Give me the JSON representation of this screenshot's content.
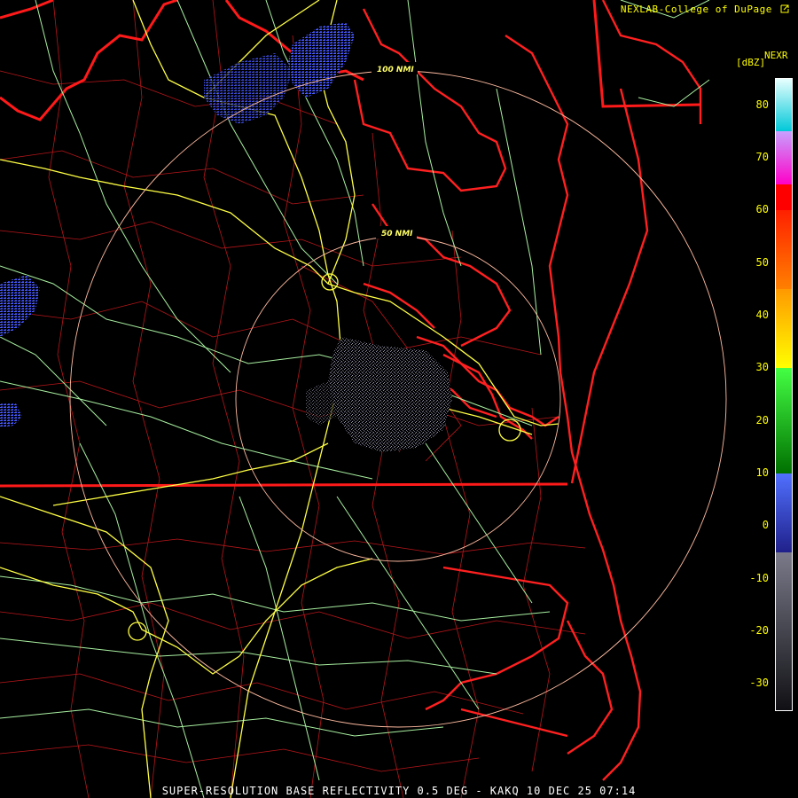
{
  "header": {
    "credit": "NEXLAB-College of DuPage",
    "credit_icon": "external-link-icon"
  },
  "legend": {
    "product": "NEXR",
    "unit": "[dBZ]",
    "min": -35,
    "max": 85,
    "ticks": [
      "80",
      "70",
      "60",
      "50",
      "40",
      "30",
      "20",
      "10",
      "0",
      "-10",
      "-20",
      "-30"
    ],
    "tick_values": [
      80,
      70,
      60,
      50,
      40,
      30,
      20,
      10,
      0,
      -10,
      -20,
      -30
    ],
    "segments": [
      {
        "from": 75,
        "to": 85,
        "color_top": "#e8ffff",
        "color_bottom": "#00c8d8"
      },
      {
        "from": 65,
        "to": 75,
        "color_top": "#c8a0ff",
        "color_bottom": "#ff00c8"
      },
      {
        "from": 60,
        "to": 65,
        "color_top": "#ff0000",
        "color_bottom": "#ff0000"
      },
      {
        "from": 45,
        "to": 60,
        "color_top": "#ff2000",
        "color_bottom": "#ff8000"
      },
      {
        "from": 30,
        "to": 45,
        "color_top": "#ff9900",
        "color_bottom": "#ffff00"
      },
      {
        "from": 10,
        "to": 30,
        "color_top": "#44ff44",
        "color_bottom": "#007000"
      },
      {
        "from": -5,
        "to": 10,
        "color_top": "#5070ff",
        "color_bottom": "#20208a"
      },
      {
        "from": -35,
        "to": -5,
        "color_top": "#7a7a8a",
        "color_bottom": "#101014"
      }
    ]
  },
  "rings": [
    {
      "label": "50 NMI",
      "nmi": 50
    },
    {
      "label": "100 NMI",
      "nmi": 100
    }
  ],
  "colors": {
    "state_border": "#ff1a1a",
    "county_border": "#c81a1a",
    "coastline": "#ff2020",
    "highway": "#ffff44",
    "road": "#a8f0a0",
    "range_ring": "#ffbba0",
    "echo_light": "#5a6aff",
    "echo_clutter": "#7c7c90"
  },
  "footer": {
    "product_line": "SUPER-RESOLUTION BASE REFLECTIVITY 0.5 DEG - KAKQ 10 DEC 25 07:14"
  }
}
